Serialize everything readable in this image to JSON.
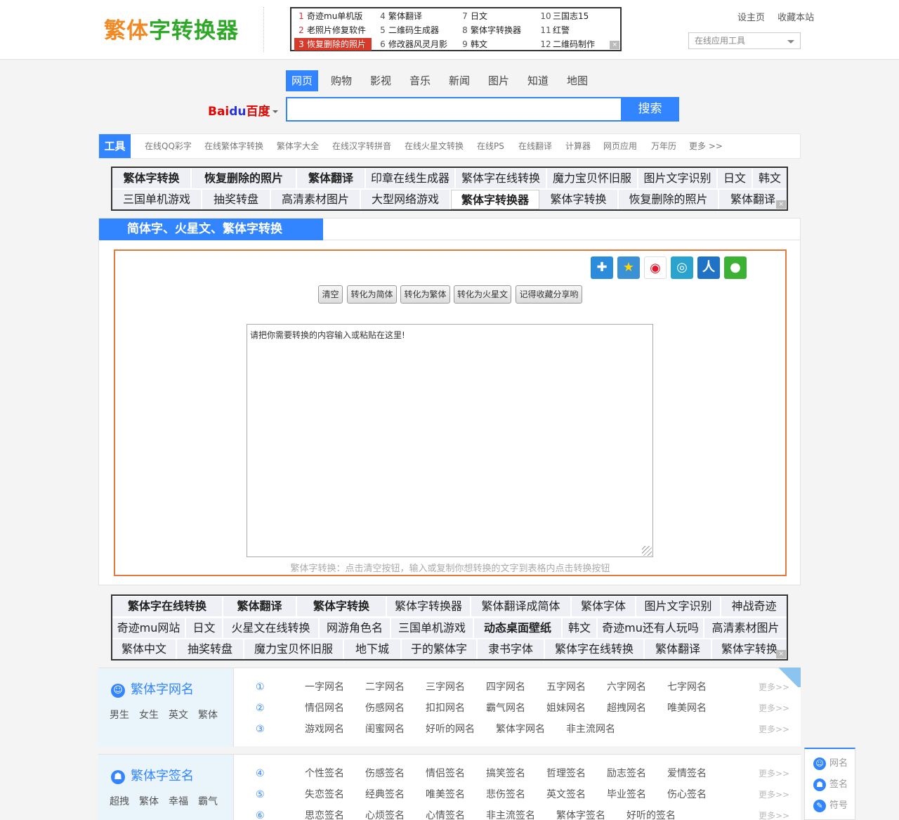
{
  "header": {
    "logo_part1": "繁体",
    "logo_part2": "字转换器",
    "set_home": "设主页",
    "bookmark": "收藏本站",
    "tool_select_value": "在线应用工具"
  },
  "top_ad": {
    "items": [
      {
        "num": "1",
        "text": "奇迹mu单机版"
      },
      {
        "num": "2",
        "text": "老照片修复软件"
      },
      {
        "num": "3",
        "text": "恢复删除的照片"
      },
      {
        "num": "4",
        "text": "繁体翻译"
      },
      {
        "num": "5",
        "text": "二维码生成器"
      },
      {
        "num": "6",
        "text": "修改器风灵月影"
      },
      {
        "num": "7",
        "text": "日文"
      },
      {
        "num": "8",
        "text": "繁体字转换器"
      },
      {
        "num": "9",
        "text": "韩文"
      },
      {
        "num": "10",
        "text": "三国志15"
      },
      {
        "num": "11",
        "text": "红警"
      },
      {
        "num": "12",
        "text": "二维码制作"
      }
    ]
  },
  "search": {
    "tabs": [
      "网页",
      "购物",
      "影视",
      "音乐",
      "新闻",
      "图片",
      "知道",
      "地图"
    ],
    "active_tab": "网页",
    "logo_text1": "Bai",
    "logo_text2": "du",
    "logo_text3": "百度",
    "button": "搜索",
    "input_value": ""
  },
  "toolbar": {
    "label": "工具",
    "links": [
      "在线QQ彩字",
      "在线繁体字转换",
      "繁体字大全",
      "在线汉字转拼音",
      "在线火星文转换",
      "在线PS",
      "在线翻译",
      "计算器",
      "网页应用",
      "万年历",
      "更多 >>"
    ]
  },
  "ad_block_1": {
    "row1": [
      "繁体字转换",
      "恢复删除的照片",
      "繁体翻译",
      "印章在线生成器",
      "繁体字在线转换",
      "魔力宝贝怀旧服",
      "图片文字识别",
      "日文",
      "韩文"
    ],
    "row2": [
      "三国单机游戏",
      "抽奖转盘",
      "高清素材图片",
      "大型网络游戏",
      "繁体字转换器",
      "繁体字转换",
      "恢复删除的照片",
      "繁体翻译"
    ]
  },
  "converter": {
    "title": "简体字、火星文、繁体字转换",
    "buttons": [
      "清空",
      "转化为简体",
      "转化为繁体",
      "转化为火星文",
      "记得收藏分享哟"
    ],
    "textarea_value": "请把你需要转换的内容输入或粘贴在这里!",
    "hint": "繁体字转换：点击清空按钮，输入或复制你想转换的文字到表格内点击转换按钮",
    "share_icons": [
      "plus-icon",
      "qzone-icon",
      "weibo-icon",
      "tencent-weibo-icon",
      "renren-icon",
      "wechat-icon"
    ]
  },
  "ad_block_2": {
    "row1": [
      "繁体字在线转换",
      "繁体翻译",
      "繁体字转换",
      "繁体字转换器",
      "繁体翻译成简体",
      "繁体字体",
      "图片文字识别",
      "神战奇迹"
    ],
    "row2": [
      "奇迹mu网站",
      "日文",
      "火星文在线转换",
      "网游角色名",
      "三国单机游戏",
      "动态桌面壁纸",
      "韩文",
      "奇迹mu还有人玩吗",
      "高清素材图片"
    ],
    "row3": [
      "繁体中文",
      "抽奖转盘",
      "魔力宝贝怀旧服",
      "地下城",
      "于的繁体字",
      "隶书字体",
      "繁体字在线转换",
      "繁体翻译",
      "繁体字转换"
    ]
  },
  "names_section": {
    "title": "繁体字网名",
    "tags": [
      "男生",
      "女生",
      "英文",
      "繁体"
    ],
    "rows": [
      {
        "num": "①",
        "items": [
          "一字网名",
          "二字网名",
          "三字网名",
          "四字网名",
          "五字网名",
          "六字网名",
          "七字网名"
        ],
        "more": "更多>>"
      },
      {
        "num": "②",
        "items": [
          "情侣网名",
          "伤感网名",
          "扣扣网名",
          "霸气网名",
          "姐妹网名",
          "超拽网名",
          "唯美网名"
        ],
        "more": "更多>>"
      },
      {
        "num": "③",
        "items": [
          "游戏网名",
          "闺蜜网名",
          "好听的网名",
          "繁体字网名",
          "非主流网名"
        ],
        "more": "更多>>"
      }
    ]
  },
  "signature_section": {
    "title": "繁体字签名",
    "tags": [
      "超拽",
      "繁体",
      "幸福",
      "霸气"
    ],
    "rows": [
      {
        "num": "④",
        "items": [
          "个性签名",
          "伤感签名",
          "情侣签名",
          "搞笑签名",
          "哲理签名",
          "励志签名",
          "爱情签名"
        ],
        "more": "更多>>"
      },
      {
        "num": "⑤",
        "items": [
          "失恋签名",
          "经典签名",
          "唯美签名",
          "悲伤签名",
          "英文签名",
          "毕业签名",
          "伤心签名"
        ],
        "more": "更多>>"
      },
      {
        "num": "⑥",
        "items": [
          "思恋签名",
          "心烦签名",
          "心情签名",
          "非主流签名",
          "繁体字签名",
          "好听的签名"
        ],
        "more": "更多>>"
      }
    ]
  },
  "side_nav": {
    "items": [
      "网名",
      "签名",
      "符号"
    ]
  }
}
